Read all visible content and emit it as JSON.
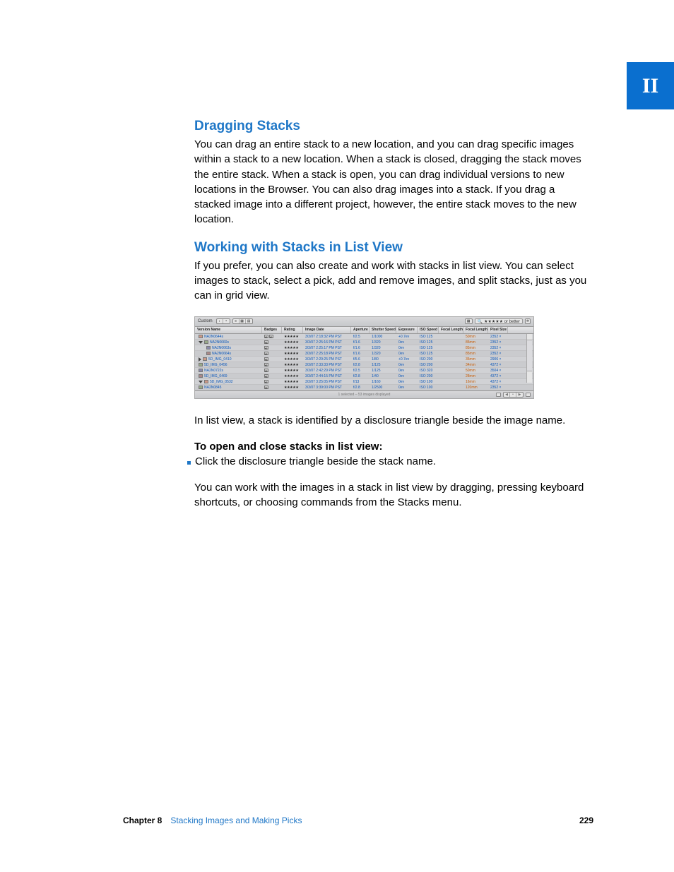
{
  "sideTab": "II",
  "sections": {
    "s1": {
      "title": "Dragging Stacks",
      "p1": "You can drag an entire stack to a new location, and you can drag specific images within a stack to a new location. When a stack is closed, dragging the stack moves the entire stack. When a stack is open, you can drag individual versions to new locations in the Browser. You can also drag images into a stack. If you drag a stacked image into a different project, however, the entire stack moves to the new location."
    },
    "s2": {
      "title": "Working with Stacks in List View",
      "p1": "If you prefer, you can also create and work with stacks in list view. You can select images to stack, select a pick, add and remove images, and split stacks, just as you can in grid view."
    }
  },
  "figure": {
    "toolbar": {
      "label": "Custom",
      "filter": "★★★★★ or better"
    },
    "columns": [
      "Version Name",
      "Badges",
      "Rating",
      "Image Date",
      "Aperture",
      "Shutter Speed",
      "Exposure",
      "ISO Speed",
      "Focal Length",
      "Focal Length",
      "Pixel Size"
    ],
    "rows": [
      {
        "disc": "",
        "name": "NA2N0644s",
        "badges": 2,
        "rating": "★★★★★",
        "date": "3/3/07 2:18:32 PM PST",
        "ap": "f/2.5",
        "ss": "1/1000",
        "exp": "+0.7ev",
        "iso": "ISO 125",
        "fl1": "",
        "fl2": "50mm",
        "px": "2352 ×"
      },
      {
        "disc": "down",
        "name": "NA2N0660s",
        "badges": 1,
        "rating": "★★★★★",
        "date": "3/3/07 2:25:16 PM PST",
        "ap": "f/1.6",
        "ss": "1/320",
        "exp": "0ev",
        "iso": "ISO 125",
        "fl1": "",
        "fl2": "85mm",
        "px": "2352 ×"
      },
      {
        "disc": "indent",
        "name": "NA2N0663s",
        "badges": 1,
        "rating": "★★★★★",
        "date": "3/3/07 2:25:17 PM PST",
        "ap": "f/1.6",
        "ss": "1/320",
        "exp": "0ev",
        "iso": "ISO 125",
        "fl1": "",
        "fl2": "85mm",
        "px": "2352 ×"
      },
      {
        "disc": "indent",
        "name": "NA2N0664s",
        "badges": 1,
        "rating": "★★★★★",
        "date": "3/3/07 2:25:18 PM PST",
        "ap": "f/1.6",
        "ss": "1/320",
        "exp": "0ev",
        "iso": "ISO 125",
        "fl1": "",
        "fl2": "85mm",
        "px": "2352 ×"
      },
      {
        "disc": "right",
        "name": "5D_IMG_0410",
        "badges": 1,
        "rating": "★★★★★",
        "date": "3/3/07 2:29:25 PM PST",
        "ap": "f/5.6",
        "ss": "1/80",
        "exp": "+0.7ev",
        "iso": "ISO 200",
        "fl1": "",
        "fl2": "35mm",
        "px": "2906 ×"
      },
      {
        "disc": "",
        "name": "5D_IMG_0456",
        "badges": 1,
        "rating": "★★★★★",
        "date": "3/3/07 2:33:33 PM PST",
        "ap": "f/2.8",
        "ss": "1/125",
        "exp": "0ev",
        "iso": "ISO 200",
        "fl1": "",
        "fl2": "34mm",
        "px": "4372 ×"
      },
      {
        "disc": "",
        "name": "NA2N0722s",
        "badges": 1,
        "rating": "★★★★★",
        "date": "3/3/07 2:42:29 PM PST",
        "ap": "f/2.5",
        "ss": "1/125",
        "exp": "0ev",
        "iso": "ISO 320",
        "fl1": "",
        "fl2": "50mm",
        "px": "3504 ×"
      },
      {
        "disc": "",
        "name": "5D_IMG_0469",
        "badges": 1,
        "rating": "★★★★★",
        "date": "3/3/07 2:44:15 PM PST",
        "ap": "f/2.8",
        "ss": "1/40",
        "exp": "0ev",
        "iso": "ISO 200",
        "fl1": "",
        "fl2": "28mm",
        "px": "4372 ×"
      },
      {
        "disc": "down",
        "name": "5D_IMG_0532",
        "badges": 1,
        "rating": "★★★★★",
        "date": "3/3/07 3:25:05 PM PST",
        "ap": "f/13",
        "ss": "1/160",
        "exp": "0ev",
        "iso": "ISO 100",
        "fl1": "",
        "fl2": "16mm",
        "px": "4372 ×"
      },
      {
        "disc": "",
        "name": "NA2N0845",
        "badges": 1,
        "rating": "★★★★★",
        "date": "3/3/07 3:39:00 PM PST",
        "ap": "f/2.8",
        "ss": "1/2500",
        "exp": "0ev",
        "iso": "ISO 100",
        "fl1": "",
        "fl2": "120mm",
        "px": "2352 ×"
      }
    ],
    "status": "1 selected – 53 images displayed"
  },
  "afterFig": {
    "p1": "In list view, a stack is identified by a disclosure triangle beside the image name.",
    "lead": "To open and close stacks in list view:",
    "bullet": "Click the disclosure triangle beside the stack name.",
    "p2": "You can work with the images in a stack in list view by dragging, pressing keyboard shortcuts, or choosing commands from the Stacks menu."
  },
  "footer": {
    "chapterLabel": "Chapter 8",
    "chapterTitle": "Stacking Images and Making Picks",
    "pageNumber": "229"
  }
}
